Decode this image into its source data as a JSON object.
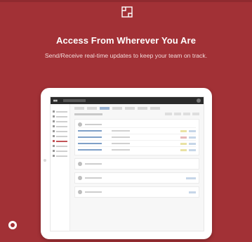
{
  "hero": {
    "title": "Access From Wherever You Are",
    "subtitle": "Send/Receive real-time updates to keep your team on track.",
    "icon": "window-icon"
  },
  "colors": {
    "background": "#a23136",
    "title": "#ffffff",
    "subtitle": "#f3dada"
  },
  "mockup": {
    "device": "tablet",
    "screen_icon": "app-screenshot"
  }
}
